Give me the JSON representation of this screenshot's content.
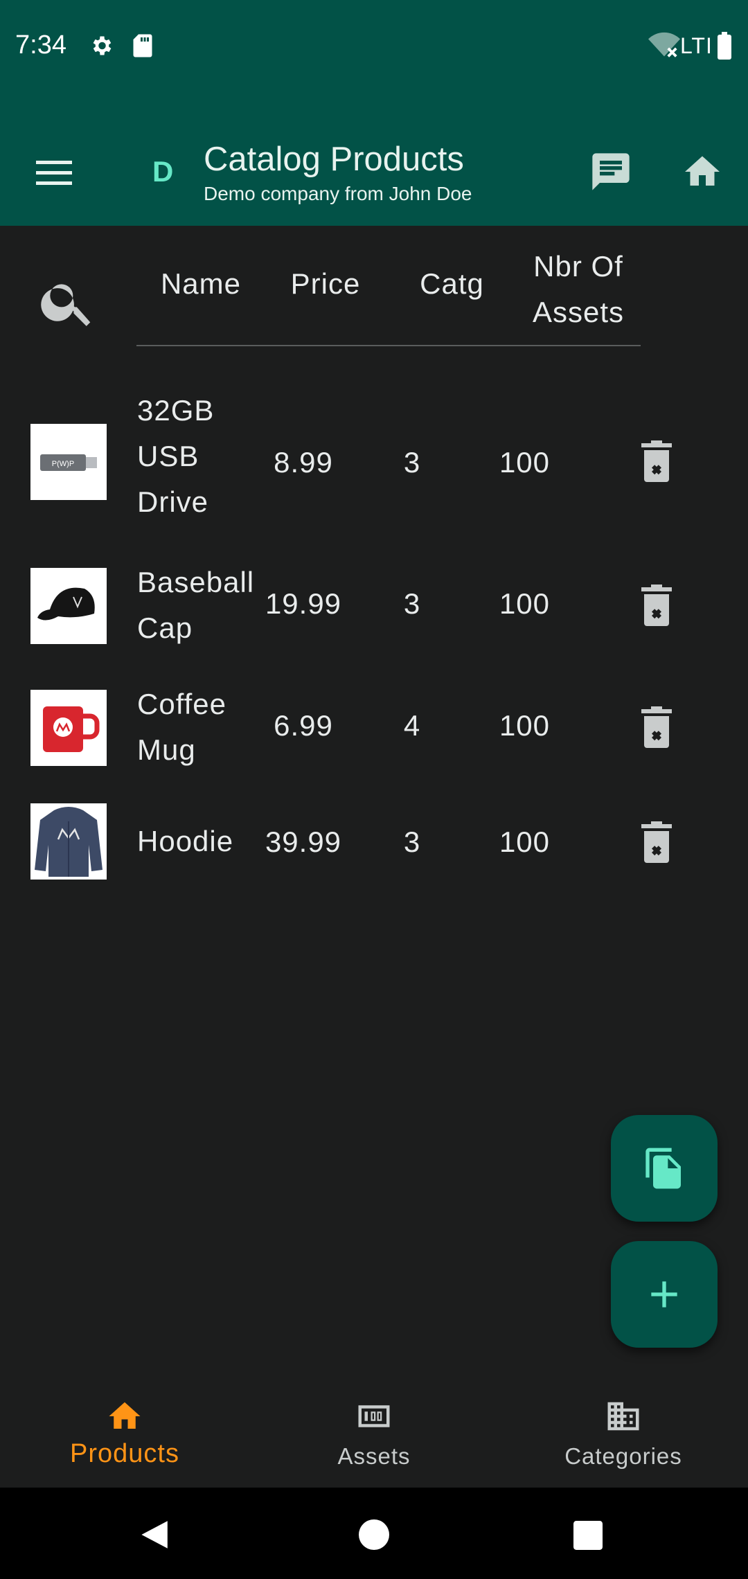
{
  "status_bar": {
    "time": "7:34",
    "network": "LTI"
  },
  "app_bar": {
    "logo_letter": "D",
    "title": "Catalog Products",
    "subtitle": "Demo company from John Doe"
  },
  "table": {
    "headers": {
      "name": "Name",
      "price": "Price",
      "catg": "Catg",
      "assets": "Nbr Of Assets"
    },
    "rows": [
      {
        "name": "32GB USB Drive",
        "price": "8.99",
        "catg": "3",
        "assets": "100",
        "image": "usb-drive"
      },
      {
        "name": "Baseball Cap",
        "price": "19.99",
        "catg": "3",
        "assets": "100",
        "image": "baseball-cap"
      },
      {
        "name": "Coffee Mug",
        "price": "6.99",
        "catg": "4",
        "assets": "100",
        "image": "coffee-mug"
      },
      {
        "name": "Hoodie",
        "price": "39.99",
        "catg": "3",
        "assets": "100",
        "image": "hoodie"
      }
    ]
  },
  "bottom_nav": {
    "items": [
      {
        "label": "Products",
        "icon": "home-icon",
        "active": true
      },
      {
        "label": "Assets",
        "icon": "counter-icon",
        "active": false
      },
      {
        "label": "Categories",
        "icon": "building-icon",
        "active": false
      }
    ]
  },
  "colors": {
    "primary": "#025247",
    "accent": "#66e8c7",
    "active_nav": "#ff9416",
    "background": "#1c1d1d"
  }
}
